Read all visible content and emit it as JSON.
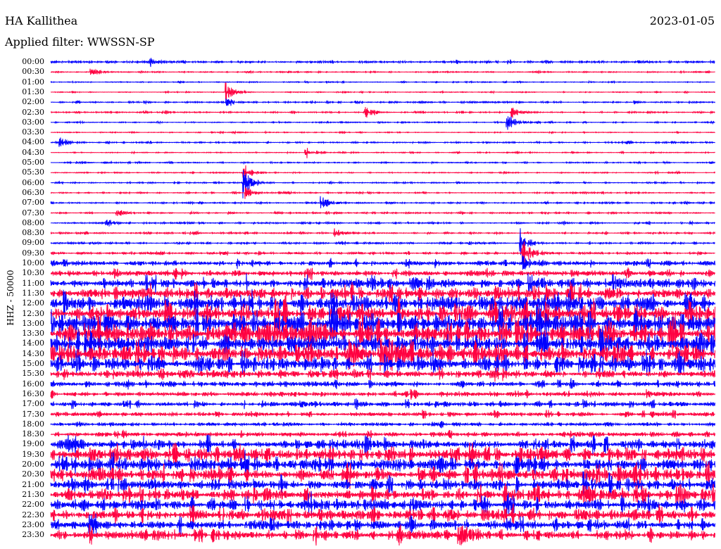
{
  "header": {
    "station": "HA Kallithea",
    "date": "2023-01-05",
    "filter": "Applied filter: WWSSN-SP"
  },
  "chart_data": {
    "type": "line",
    "title": "HA Kallithea",
    "ylabel": "HHZ - 50000",
    "xlabel": "",
    "minutes_per_line": 30,
    "colors": [
      "#0000ff",
      "#ff0040"
    ],
    "rows": [
      "00:00",
      "00:30",
      "01:00",
      "01:30",
      "02:00",
      "02:30",
      "03:00",
      "03:30",
      "04:00",
      "04:30",
      "05:00",
      "05:30",
      "06:00",
      "06:30",
      "07:00",
      "07:30",
      "08:00",
      "08:30",
      "09:00",
      "09:30",
      "10:00",
      "10:30",
      "11:00",
      "11:30",
      "12:00",
      "12:30",
      "13:00",
      "13:30",
      "14:00",
      "14:30",
      "15:00",
      "15:30",
      "16:00",
      "16:30",
      "17:00",
      "17:30",
      "18:00",
      "18:30",
      "19:00",
      "19:30",
      "20:00",
      "20:30",
      "21:00",
      "21:30",
      "22:00",
      "22:30",
      "23:00",
      "23:30"
    ],
    "noise_level": [
      1.2,
      0.6,
      0.5,
      0.5,
      0.8,
      0.8,
      0.6,
      0.5,
      0.8,
      0.5,
      0.6,
      0.6,
      0.7,
      0.7,
      0.8,
      0.8,
      0.9,
      0.9,
      1.0,
      1.2,
      2.5,
      3,
      5,
      6,
      8,
      9,
      10,
      10,
      9,
      9,
      8,
      4,
      3,
      2.5,
      2.5,
      2,
      2,
      2.5,
      5,
      7,
      7,
      7,
      6,
      6,
      6,
      6,
      5,
      5
    ],
    "events": [
      {
        "row": 0,
        "minute": 4.5,
        "amp": 5
      },
      {
        "row": 1,
        "minute": 1.8,
        "amp": 5
      },
      {
        "row": 3,
        "minute": 7.9,
        "amp": 14
      },
      {
        "row": 4,
        "minute": 7.9,
        "amp": 10
      },
      {
        "row": 5,
        "minute": 14.2,
        "amp": 8
      },
      {
        "row": 5,
        "minute": 20.8,
        "amp": 9
      },
      {
        "row": 6,
        "minute": 20.6,
        "amp": 14
      },
      {
        "row": 8,
        "minute": 0.4,
        "amp": 8
      },
      {
        "row": 9,
        "minute": 11.5,
        "amp": 10
      },
      {
        "row": 11,
        "minute": 8.7,
        "amp": 14
      },
      {
        "row": 12,
        "minute": 8.7,
        "amp": 22
      },
      {
        "row": 13,
        "minute": 8.8,
        "amp": 10
      },
      {
        "row": 14,
        "minute": 12.2,
        "amp": 10
      },
      {
        "row": 15,
        "minute": 3.0,
        "amp": 5
      },
      {
        "row": 16,
        "minute": 2.5,
        "amp": 6
      },
      {
        "row": 17,
        "minute": 12.8,
        "amp": 6
      },
      {
        "row": 18,
        "minute": 21.2,
        "amp": 20
      },
      {
        "row": 19,
        "minute": 21.3,
        "amp": 22
      },
      {
        "row": 20,
        "minute": 21.3,
        "amp": 12
      },
      {
        "row": 47,
        "minute": 18.4,
        "amp": 14
      }
    ]
  }
}
